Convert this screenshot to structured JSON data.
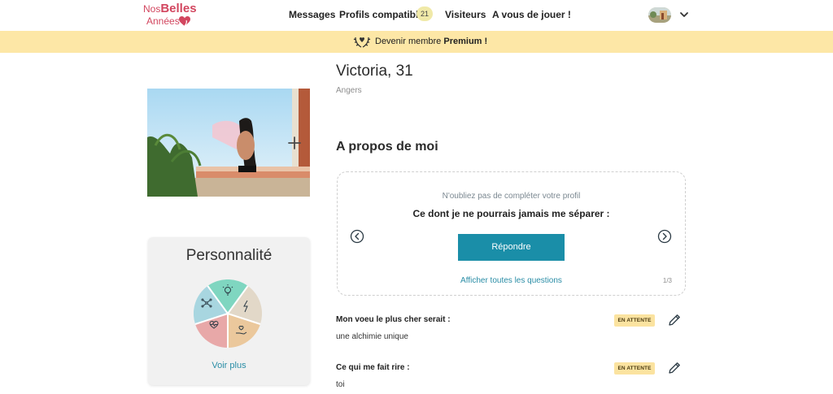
{
  "logo": {
    "line1_prefix": "Nos",
    "line1_bold": "Belles",
    "line2": "Années"
  },
  "nav": {
    "messages": "Messages",
    "profils": "Profils compatibles",
    "profils_count": "21",
    "visiteurs": "Visiteurs",
    "jeu": "A vous de jouer !"
  },
  "premium": {
    "prefix": "Devenir membre",
    "bold": "Premium !"
  },
  "profile": {
    "name": "Victoria, 31",
    "city": "Angers"
  },
  "personality": {
    "title": "Personnalité",
    "more": "Voir plus",
    "segments": [
      "lightbulb-icon",
      "lightning-icon",
      "hand-heart-icon",
      "heart-pulse-icon",
      "network-icon"
    ],
    "colors": [
      "#7fd6c0",
      "#e2d8c8",
      "#ebc89c",
      "#e8a8a8",
      "#a8d6e0"
    ]
  },
  "about": {
    "title": "A propos de moi",
    "hint": "N'oubliez pas de compléter votre profil",
    "question": "Ce dont je ne pourrais jamais me séparer :",
    "reply": "Répondre",
    "all_questions": "Afficher toutes les questions",
    "pager": "1/3"
  },
  "answers": [
    {
      "label": "Mon voeu le plus cher serait :",
      "answer": "une alchimie unique",
      "status": "EN ATTENTE"
    },
    {
      "label": "Ce qui me fait rire :",
      "answer": "toi",
      "status": "EN ATTENTE"
    }
  ],
  "colors": {
    "accent": "#1a8ea8",
    "brand": "#d2465f",
    "premium_bg": "#fde7a6",
    "status_bg": "#fbe3a0"
  }
}
